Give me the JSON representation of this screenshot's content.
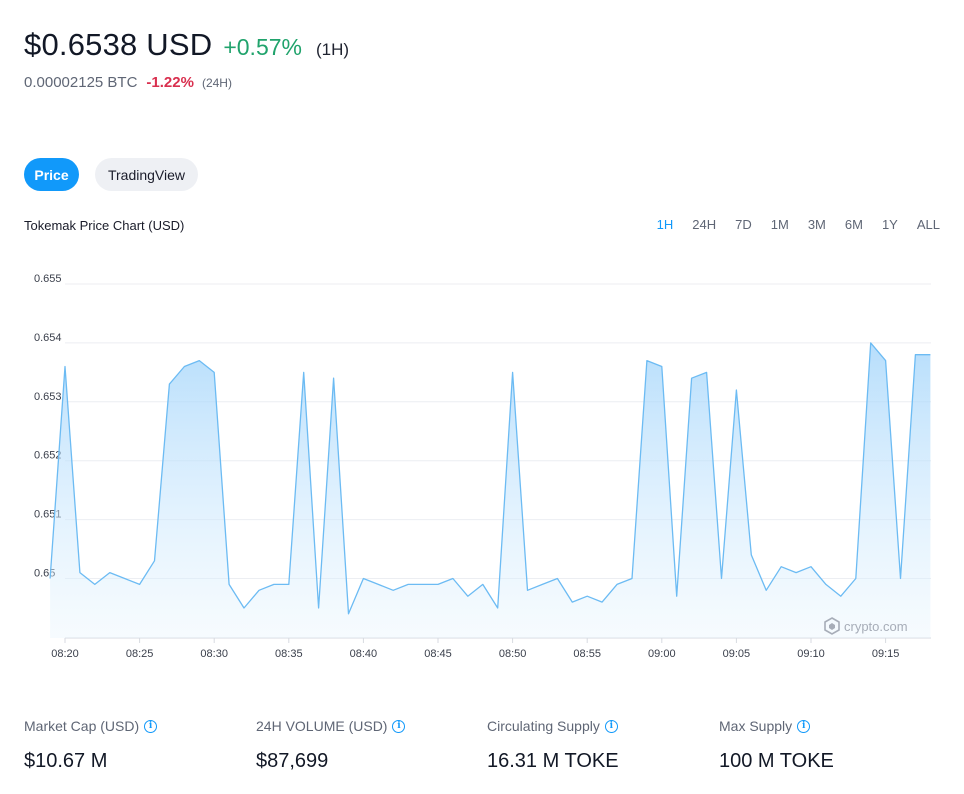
{
  "header": {
    "price": "$0.6538 USD",
    "change": "+0.57%",
    "change_period": "(1H)",
    "btc_value": "0.00002125 BTC",
    "btc_change": "-1.22%",
    "btc_period": "(24H)"
  },
  "tabs": {
    "price": "Price",
    "tradingview": "TradingView"
  },
  "chart_title": "Tokemak Price Chart (USD)",
  "ranges": [
    "1H",
    "24H",
    "7D",
    "1M",
    "3M",
    "6M",
    "1Y",
    "ALL"
  ],
  "active_range": "1H",
  "watermark": "crypto.com",
  "colors": {
    "accent": "#1199fa",
    "line": "#6cbbf3",
    "positive": "#20a36c",
    "negative": "#d9304f"
  },
  "stats": [
    {
      "label": "Market Cap (USD)",
      "value": "$10.67 M"
    },
    {
      "label": "24H VOLUME (USD)",
      "value": "$87,699"
    },
    {
      "label": "Circulating Supply",
      "value": "16.31 M TOKE"
    },
    {
      "label": "Max Supply",
      "value": "100 M TOKE"
    }
  ],
  "chart_data": {
    "type": "area",
    "title": "Tokemak Price Chart (USD)",
    "xlabel": "",
    "ylabel": "",
    "x_ticks": [
      "08:20",
      "08:25",
      "08:30",
      "08:35",
      "08:40",
      "08:45",
      "08:50",
      "08:55",
      "09:00",
      "09:05",
      "09:10",
      "09:15"
    ],
    "y_ticks": [
      "0.655",
      "0.654",
      "0.653",
      "0.652",
      "0.651",
      "0.65"
    ],
    "ylim": [
      0.6489,
      0.6551
    ],
    "xlim_minutes_after_0820": [
      0,
      58
    ],
    "grid": true,
    "series": [
      {
        "x": [
          "08:19",
          "08:20",
          "08:21",
          "08:22",
          "08:23",
          "08:24",
          "08:25",
          "08:26",
          "08:27",
          "08:28",
          "08:29",
          "08:30",
          "08:31",
          "08:32",
          "08:33",
          "08:34",
          "08:35",
          "08:36",
          "08:37",
          "08:38",
          "08:39",
          "08:40",
          "08:41",
          "08:42",
          "08:43",
          "08:44",
          "08:45",
          "08:46",
          "08:47",
          "08:48",
          "08:49",
          "08:50",
          "08:51",
          "08:52",
          "08:53",
          "08:54",
          "08:55",
          "08:56",
          "08:57",
          "08:58",
          "08:59",
          "09:00",
          "09:01",
          "09:02",
          "09:03",
          "09:04",
          "09:05",
          "09:06",
          "09:07",
          "09:08",
          "09:09",
          "09:10",
          "09:11",
          "09:12",
          "09:13",
          "09:14",
          "09:15",
          "09:16",
          "09:17",
          "09:18"
        ],
        "y": [
          0.65,
          0.6536,
          0.6501,
          0.6499,
          0.6501,
          0.65,
          0.6499,
          0.6503,
          0.6533,
          0.6536,
          0.6537,
          0.6535,
          0.6499,
          0.6495,
          0.6498,
          0.6499,
          0.6499,
          0.6535,
          0.6495,
          0.6534,
          0.6494,
          0.65,
          0.6499,
          0.6498,
          0.6499,
          0.6499,
          0.6499,
          0.65,
          0.6497,
          0.6499,
          0.6495,
          0.6535,
          0.6498,
          0.6499,
          0.65,
          0.6496,
          0.6497,
          0.6496,
          0.6499,
          0.65,
          0.6537,
          0.6536,
          0.6497,
          0.6534,
          0.6535,
          0.65,
          0.6532,
          0.6504,
          0.6498,
          0.6502,
          0.6501,
          0.6502,
          0.6499,
          0.6497,
          0.65,
          0.654,
          0.6537,
          0.65,
          0.6538,
          0.6538
        ]
      }
    ]
  }
}
